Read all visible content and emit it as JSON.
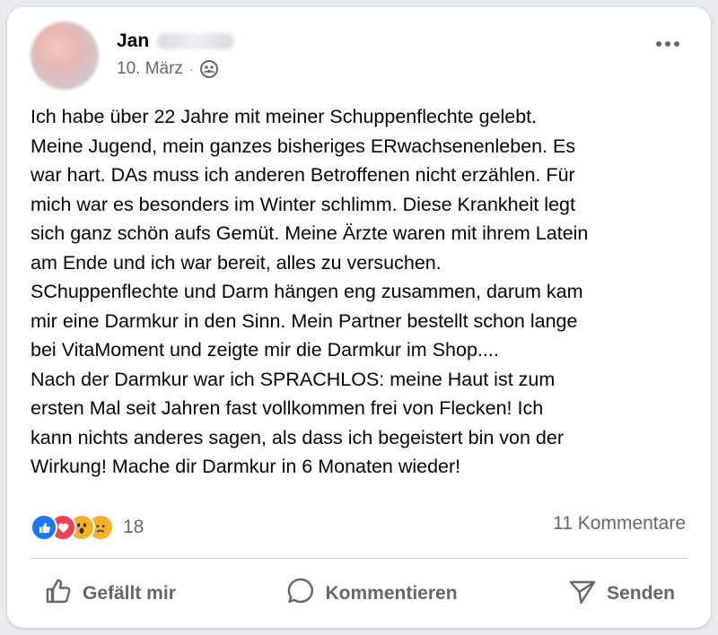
{
  "post": {
    "author_first_name": "Jan",
    "date": "10. März",
    "dot": "·",
    "audience_icon": "friends-icon",
    "more_icon": "more-options-icon",
    "text": "Ich habe über 22 Jahre mit meiner Schuppenflechte gelebt.\nMeine Jugend, mein ganzes bisheriges ERwachsenenleben. Es\nwar hart. DAs muss ich anderen Betroffenen nicht erzählen. Für\nmich war es besonders im Winter schlimm. Diese Krankheit legt\nsich ganz schön aufs Gemüt. Meine Ärzte waren mit ihrem Latein\nam Ende und ich war bereit, alles zu versuchen.\nSChuppenflechte und Darm hängen eng zusammen, darum kam\nmir eine Darmkur in den Sinn. Mein Partner bestellt schon lange\nbei VitaMoment und zeigte mir die Darmkur im Shop....\nNach der Darmkur war ich SPRACHLOS: meine Haut ist zum\nersten Mal seit Jahren fast vollkommen frei von Flecken! Ich\nkann nichts anderes sagen, als dass ich begeistert bin von der\nWirkung! Mache dir Darmkur in 6 Monaten wieder!"
  },
  "stats": {
    "reaction_icons": [
      "like-icon",
      "love-icon",
      "wow-icon",
      "sad-icon"
    ],
    "reaction_count": "18",
    "comments_label": "11 Kommentare"
  },
  "actions": {
    "like": {
      "label": "Gefällt mir",
      "icon": "thumbs-up-icon"
    },
    "comment": {
      "label": "Kommentieren",
      "icon": "comment-icon"
    },
    "share": {
      "label": "Senden",
      "icon": "send-icon"
    }
  },
  "colors": {
    "like_blue": "#1877f2",
    "love_red": "#f33e58",
    "emoji_yellow": "#f7b125",
    "secondary_text": "#65676b"
  }
}
